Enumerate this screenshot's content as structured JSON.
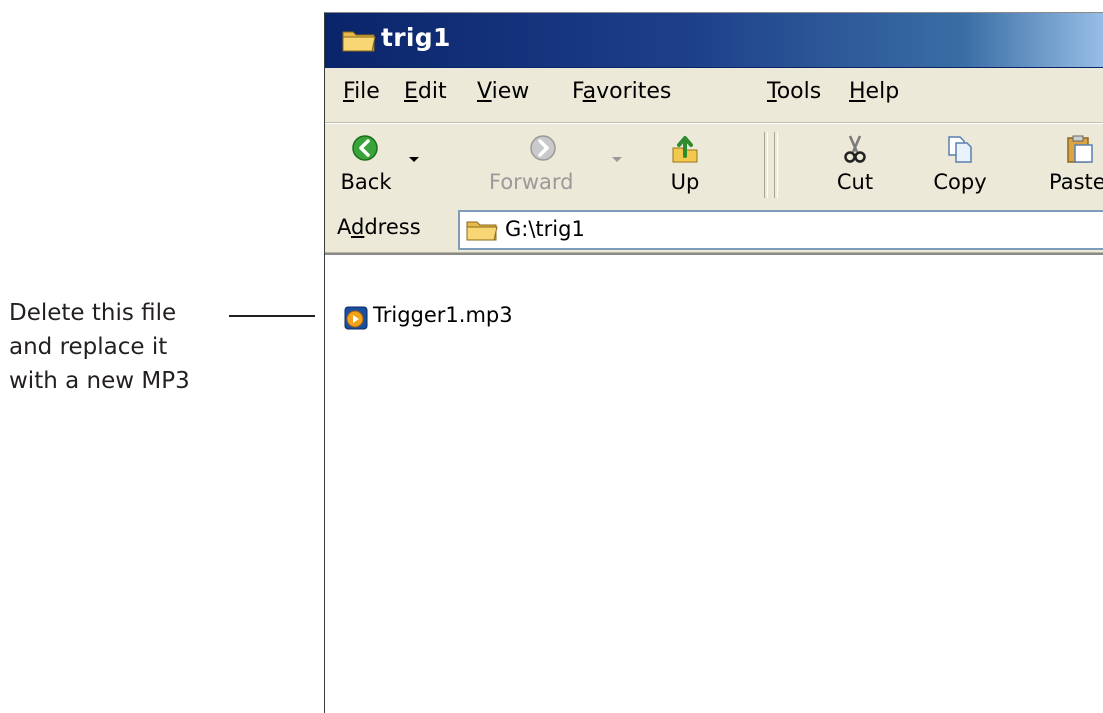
{
  "annotation": {
    "lines": [
      "Delete this file",
      "and replace it",
      "with a new MP3"
    ]
  },
  "window": {
    "title": "trig1",
    "menu": [
      {
        "pre": "",
        "u": "F",
        "post": "ile"
      },
      {
        "pre": "",
        "u": "E",
        "post": "dit"
      },
      {
        "pre": "",
        "u": "V",
        "post": "iew"
      },
      {
        "pre": "F",
        "u": "a",
        "post": "vorites"
      },
      {
        "pre": "",
        "u": "T",
        "post": "ools"
      },
      {
        "pre": "",
        "u": "H",
        "post": "elp"
      }
    ],
    "toolbar": {
      "back_label": "Back",
      "forward_label": "Forward",
      "up_label": "Up",
      "cut_label": "Cut",
      "copy_label": "Copy",
      "paste_label": "Paste"
    },
    "address": {
      "label_pre": "A",
      "label_u": "d",
      "label_post": "dress",
      "value": "G:\\trig1"
    },
    "files": [
      {
        "name": "Trigger1.mp3",
        "icon": "media-file-icon"
      }
    ]
  },
  "colors": {
    "titlebar": "#0a246a",
    "chrome": "#ece9d8",
    "annotation_text": "#231f20"
  }
}
